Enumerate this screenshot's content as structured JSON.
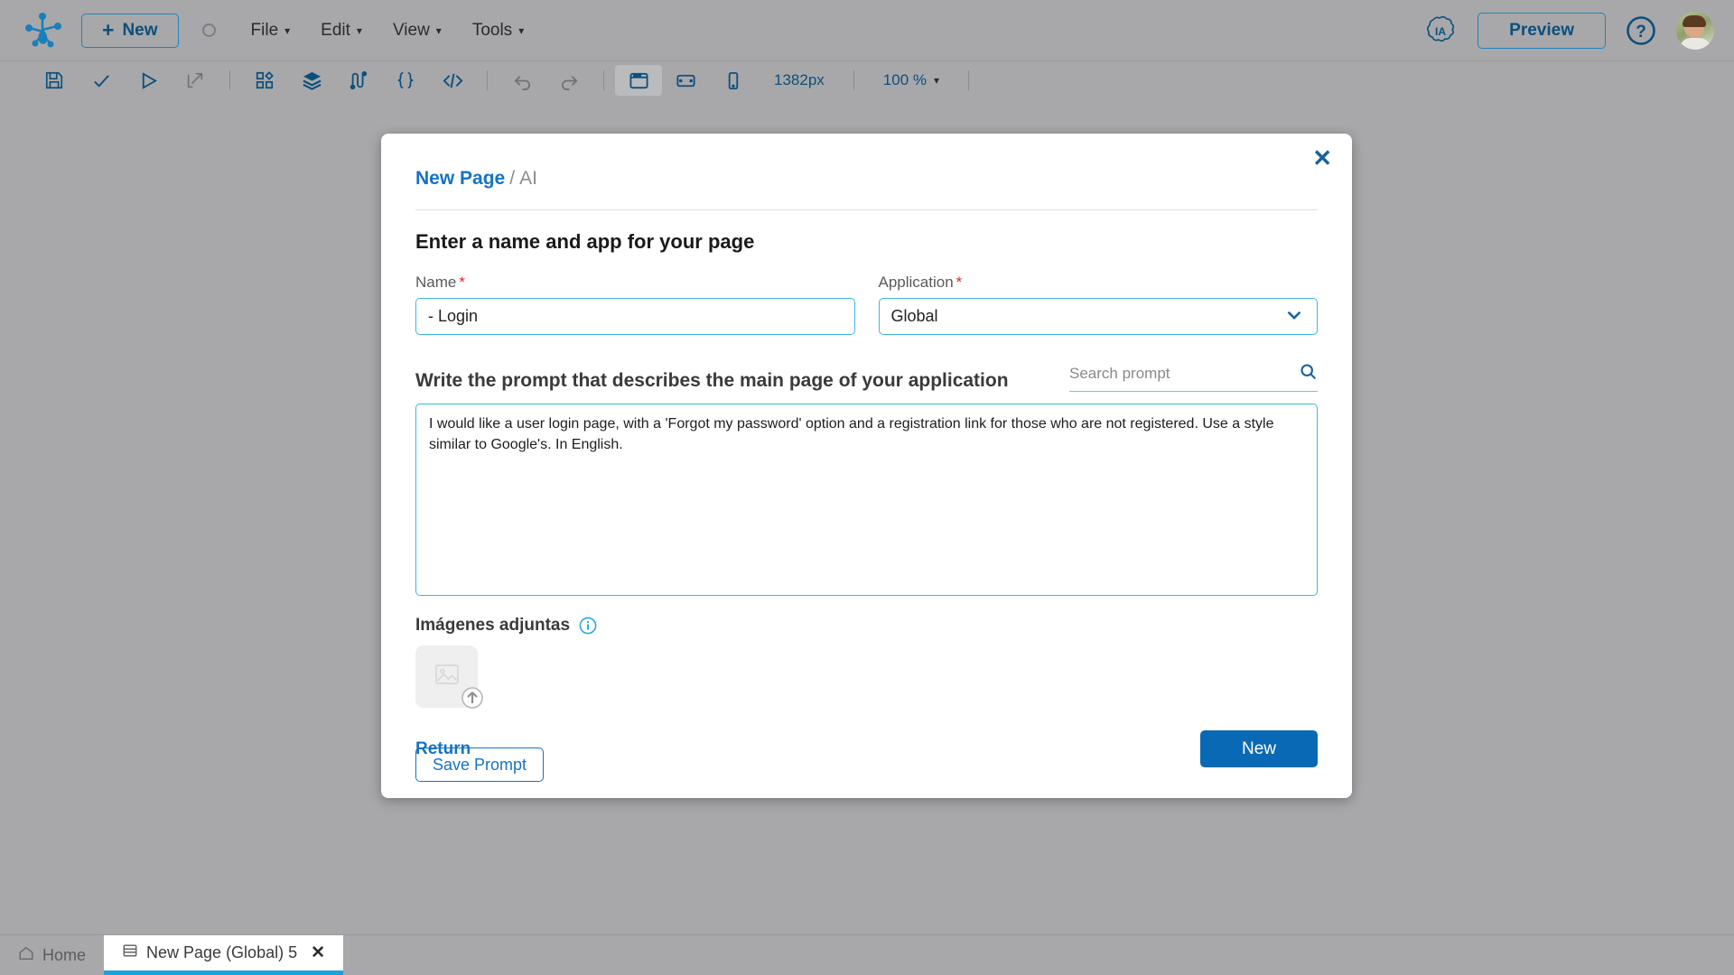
{
  "app": {
    "logo_icon": "app-logo-icon"
  },
  "menubar": {
    "new_button": "New",
    "status_icon": "record-circle-icon",
    "items": [
      {
        "label": "File",
        "icon": "chevron-down-icon"
      },
      {
        "label": "Edit",
        "icon": "chevron-down-icon"
      },
      {
        "label": "View",
        "icon": "chevron-down-icon"
      },
      {
        "label": "Tools",
        "icon": "chevron-down-icon"
      }
    ],
    "ia_badge": "IA",
    "ia_badge_icon": "ai-cloud-icon",
    "preview_button": "Preview",
    "help_icon": "help-question-icon",
    "avatar_icon": "user-avatar"
  },
  "toolbar": {
    "icons": [
      {
        "name": "save-icon",
        "glyph": "save"
      },
      {
        "name": "check-icon",
        "glyph": "check"
      },
      {
        "name": "run-icon",
        "glyph": "play"
      },
      {
        "name": "export-icon",
        "glyph": "arrow-out"
      },
      {
        "name": "components-icon",
        "glyph": "grid"
      },
      {
        "name": "layers-icon",
        "glyph": "layers"
      },
      {
        "name": "flow-icon",
        "glyph": "flow"
      },
      {
        "name": "braces-icon",
        "glyph": "braces"
      },
      {
        "name": "code-icon",
        "glyph": "code"
      },
      {
        "name": "undo-icon",
        "glyph": "undo"
      },
      {
        "name": "redo-icon",
        "glyph": "redo"
      },
      {
        "name": "desktop-view-icon",
        "glyph": "desktop"
      },
      {
        "name": "tablet-view-icon",
        "glyph": "tablet"
      },
      {
        "name": "mobile-view-icon",
        "glyph": "mobile"
      }
    ],
    "width_value": "1382px",
    "zoom_value": "100 %",
    "zoom_caret": "chevron-down-icon"
  },
  "modal": {
    "close_icon": "close-icon",
    "breadcrumb": {
      "main": "New Page",
      "separator": "/",
      "sub": "AI"
    },
    "title": "Enter a name and app for your page",
    "name_field": {
      "label": "Name",
      "required_mark": "*",
      "value": "- Login"
    },
    "application_field": {
      "label": "Application",
      "required_mark": "*",
      "value": "Global",
      "caret_icon": "chevron-down-icon"
    },
    "prompt_section": {
      "label": "Write the prompt that describes the main page of your application",
      "search_placeholder": "Search prompt",
      "search_value": "",
      "search_icon": "search-icon",
      "textarea_value": "I would like a user login page, with a 'Forgot my password' option and a registration link for those who are not registered. Use a style similar to Google's. In English."
    },
    "images_section": {
      "title": "Imágenes adjuntas",
      "info_icon": "info-icon",
      "upload_tile_icon": "image-placeholder-icon",
      "upload_badge_icon": "upload-arrow-icon"
    },
    "save_prompt_button": "Save Prompt",
    "return_link": "Return",
    "new_button": "New"
  },
  "tabbar": {
    "tabs": [
      {
        "label": "Home",
        "icon": "home-icon",
        "active": false,
        "closable": false
      },
      {
        "label": "New Page (Global) 5",
        "icon": "page-icon",
        "active": true,
        "closable": true,
        "close_icon": "close-icon"
      }
    ]
  },
  "colors": {
    "chrome_bg": "#a8a8aa",
    "accent_blue": "#0a69b4",
    "link_blue": "#1573c4",
    "border_cyan": "#3fb6e0",
    "required_red": "#e8242a",
    "active_tab_underline": "#18a3dc"
  }
}
